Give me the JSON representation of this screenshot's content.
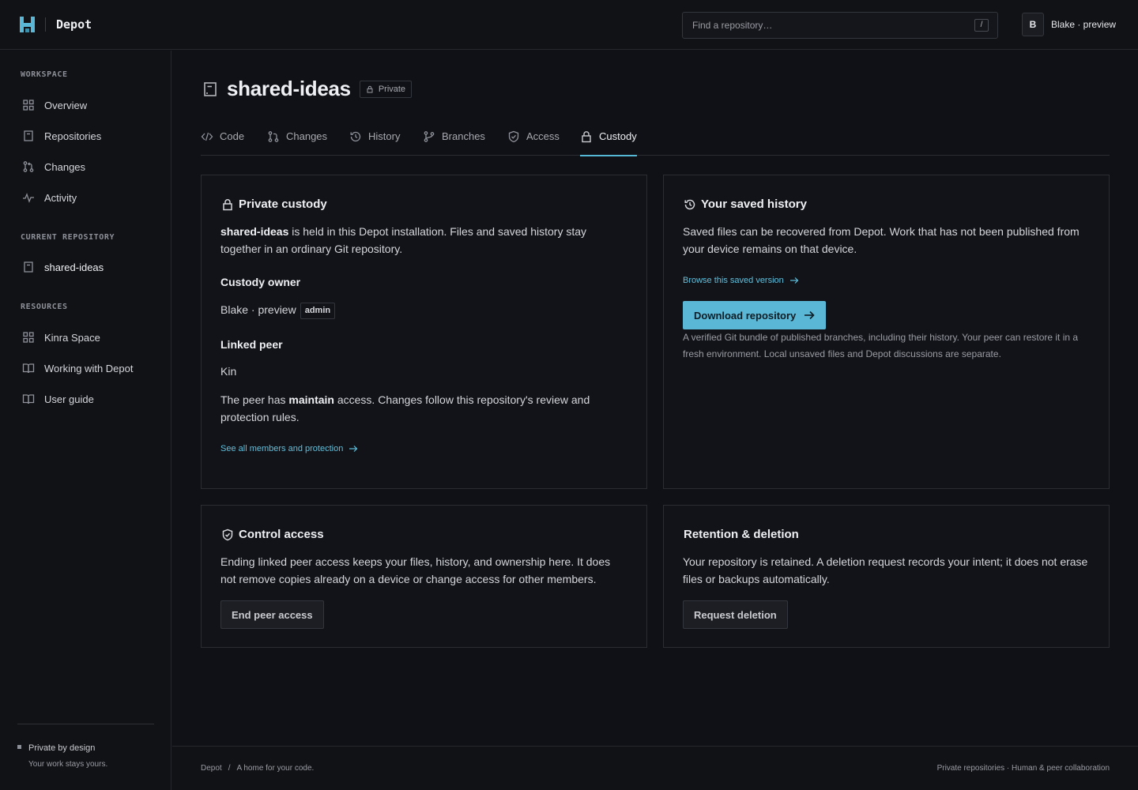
{
  "app": {
    "name": "Depot"
  },
  "header": {
    "search_placeholder": "Find a repository…",
    "search_shortcut": "/",
    "user_initial": "B",
    "user_name": "Blake · preview"
  },
  "sidebar": {
    "sections": [
      {
        "label": "WORKSPACE",
        "items": [
          {
            "label": "Overview",
            "icon": "grid-icon"
          },
          {
            "label": "Repositories",
            "icon": "repo-icon"
          },
          {
            "label": "Changes",
            "icon": "pull-request-icon"
          },
          {
            "label": "Activity",
            "icon": "pulse-icon"
          }
        ]
      },
      {
        "label": "CURRENT REPOSITORY",
        "items": [
          {
            "label": "shared-ideas",
            "icon": "repo-icon"
          }
        ]
      },
      {
        "label": "RESOURCES",
        "items": [
          {
            "label": "Kinra Space",
            "icon": "grid-icon"
          },
          {
            "label": "Working with Depot",
            "icon": "book-icon"
          },
          {
            "label": "User guide",
            "icon": "book-icon"
          }
        ]
      }
    ],
    "footer_title": "Private by design",
    "footer_sub": "Your work stays yours."
  },
  "repo": {
    "name": "shared-ideas",
    "visibility": "Private"
  },
  "tabs": [
    {
      "label": "Code",
      "icon": "code-icon"
    },
    {
      "label": "Changes",
      "icon": "pull-request-icon"
    },
    {
      "label": "History",
      "icon": "history-icon"
    },
    {
      "label": "Branches",
      "icon": "branch-icon"
    },
    {
      "label": "Access",
      "icon": "shield-icon"
    },
    {
      "label": "Custody",
      "icon": "lock-icon",
      "active": true
    }
  ],
  "cards": {
    "custody": {
      "title": "Private custody",
      "intro_bold": "shared-ideas",
      "intro_rest_1": " is held in this Depot installation. Files and saved history stay",
      "intro_rest_2": "together in an ordinary Git repository.",
      "owner_heading": "Custody owner",
      "owner_name": "Blake · preview",
      "owner_role": "admin",
      "peer_heading": "Linked peer",
      "peer_name": "Kin",
      "peer_text_1a": "The peer has ",
      "peer_text_1b": "maintain",
      "peer_text_1c": " access. Changes follow this repository's review and",
      "peer_text_2": "protection rules.",
      "link": "See all members and protection"
    },
    "history": {
      "title": "Your saved history",
      "text_1": "Saved files can be recovered from Depot. Work that has not been published from",
      "text_2": "your device remains on that device.",
      "link": "Browse this saved version",
      "button": "Download repository",
      "note_1": "A verified Git bundle of published branches, including their history. Your peer can restore it in a",
      "note_2": "fresh environment. Local unsaved files and Depot discussions are separate."
    },
    "access": {
      "title": "Control access",
      "text_1": "Ending linked peer access keeps your files, history, and ownership here. It does",
      "text_2": "not remove copies already on a device or change access for other members.",
      "button": "End peer access"
    },
    "retention": {
      "title": "Retention & deletion",
      "text_1": "Your repository is retained. A deletion request records your intent; it does not erase",
      "text_2": "files or backups automatically.",
      "button": "Request deletion"
    }
  },
  "footer": {
    "left_1": "Depot",
    "left_sep": "/",
    "left_2": "A home for your code.",
    "right": "Private repositories · Human & peer collaboration"
  },
  "colors": {
    "accent": "#5ab8d6",
    "background": "#101116",
    "panel": "#121318",
    "border": "#2b2d33"
  }
}
